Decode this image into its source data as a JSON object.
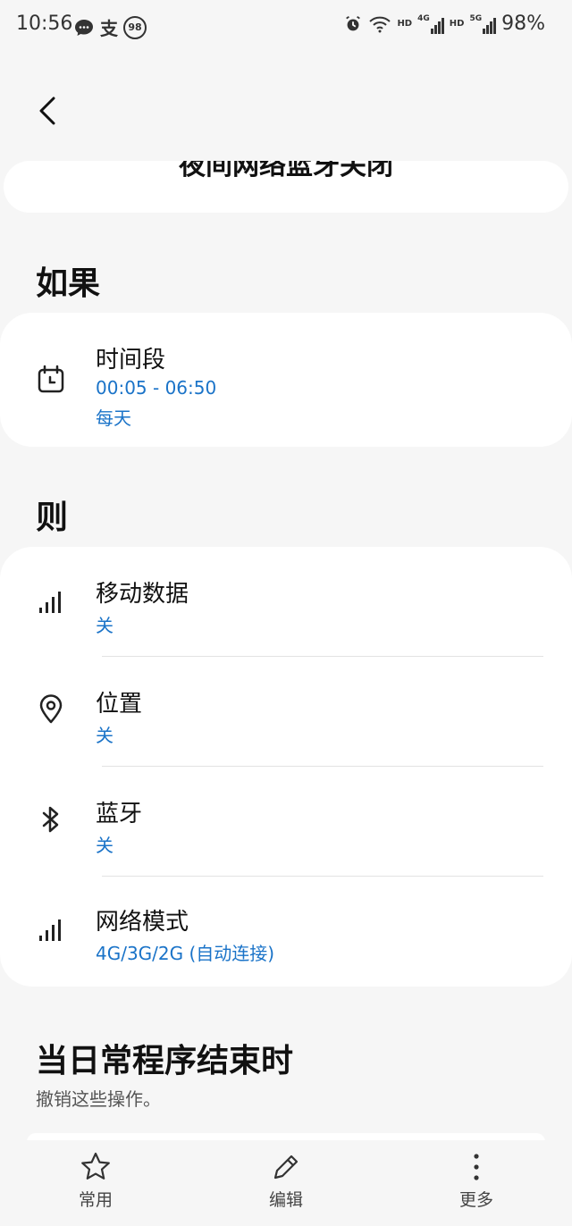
{
  "status_bar": {
    "time": "10:56",
    "battery": "98%",
    "notif_badge": "98",
    "alipay_char": "支",
    "hd1": "HD",
    "hd2": "HD",
    "net1": "4G",
    "net2": "5G",
    "icons": [
      "chat-icon",
      "alipay-icon",
      "badge-98-icon",
      "alarm-icon",
      "wifi-icon",
      "signal-icon",
      "signal-icon"
    ]
  },
  "header": {
    "routine_title": "夜间网络蓝牙关闭"
  },
  "if_section": {
    "heading": "如果",
    "condition": {
      "icon": "calendar-icon",
      "title": "时间段",
      "time_range": "00:05 - 06:50",
      "repeat": "每天"
    }
  },
  "then_section": {
    "heading": "则",
    "actions": [
      {
        "icon": "signal-bars-icon",
        "title": "移动数据",
        "value": "关"
      },
      {
        "icon": "location-icon",
        "title": "位置",
        "value": "关"
      },
      {
        "icon": "bluetooth-icon",
        "title": "蓝牙",
        "value": "关"
      },
      {
        "icon": "signal-bars-icon",
        "title": "网络模式",
        "value": "4G/3G/2G (自动连接)"
      }
    ]
  },
  "end_section": {
    "heading": "当日常程序结束时",
    "subtitle": "撤销这些操作。"
  },
  "bottom_nav": {
    "items": [
      {
        "icon": "star-icon",
        "label": "常用"
      },
      {
        "icon": "pencil-icon",
        "label": "编辑"
      },
      {
        "icon": "more-vertical-icon",
        "label": "更多"
      }
    ]
  },
  "colors": {
    "accent": "#1a73c8",
    "background": "#f6f6f6",
    "card": "#ffffff"
  }
}
